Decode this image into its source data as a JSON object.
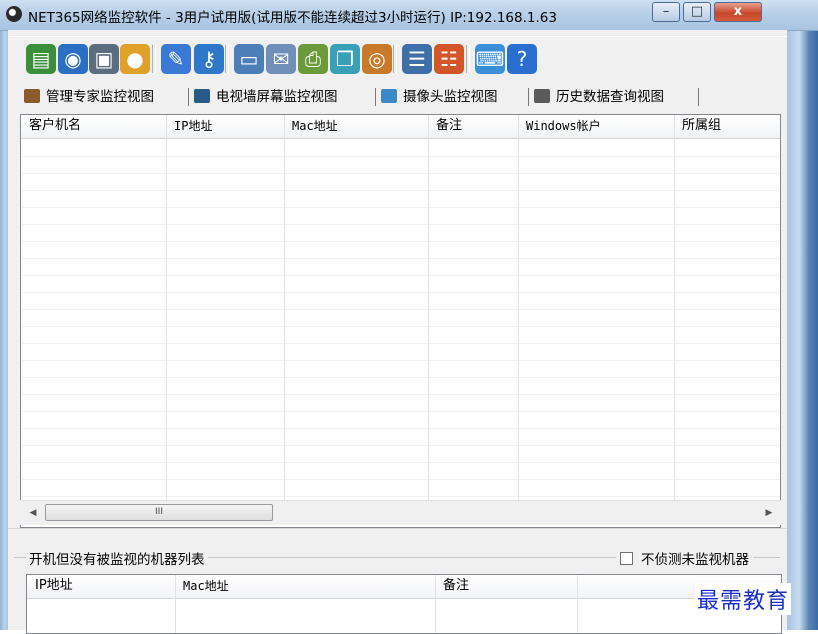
{
  "window": {
    "title": "NET365网络监控软件 - 3用户试用版(试用版不能连续超过3小时运行) IP:192.168.1.63",
    "minimize_glyph": "–",
    "maximize_glyph": "□",
    "close_glyph": "x"
  },
  "toolbar": {
    "buttons": [
      {
        "icon": "windows-stack-icon",
        "glyph": "▤",
        "color": "#3a8f3a"
      },
      {
        "icon": "globe-icon",
        "glyph": "◉",
        "color": "#2a6fc2"
      },
      {
        "icon": "monitor-settings-icon",
        "glyph": "▣",
        "color": "#5d6d80"
      },
      {
        "icon": "users-icon",
        "glyph": "●",
        "color": "#e0a12a"
      },
      {
        "icon": "chart-pen-icon",
        "glyph": "✎",
        "color": "#3a7ad6"
      },
      {
        "icon": "key-icon",
        "glyph": "⚷",
        "color": "#2f78c9"
      },
      {
        "icon": "remote-monitor-icon",
        "glyph": "▭",
        "color": "#4c7fb8"
      },
      {
        "icon": "mail-icon",
        "glyph": "✉",
        "color": "#6f8fb8"
      },
      {
        "icon": "document-search-icon",
        "glyph": "⎙",
        "color": "#6a9a3a"
      },
      {
        "icon": "windows-copy-icon",
        "glyph": "❐",
        "color": "#3aa0b8"
      },
      {
        "icon": "disc-icon",
        "glyph": "◎",
        "color": "#c87a2a"
      },
      {
        "icon": "list-panel-icon",
        "glyph": "☰",
        "color": "#3e6fa8"
      },
      {
        "icon": "user-report-icon",
        "glyph": "☷",
        "color": "#d2562a"
      },
      {
        "icon": "keyboard-icon",
        "glyph": "⌨",
        "color": "#3b8fd8"
      },
      {
        "icon": "help-icon",
        "glyph": "?",
        "color": "#2a6fd0"
      }
    ]
  },
  "tabs": [
    {
      "label": "管理专家监控视图",
      "icon": "manager-icon",
      "color": "#8a5a2a"
    },
    {
      "label": "电视墙屏幕监控视图",
      "icon": "tv-wall-icon",
      "color": "#2a5a8a"
    },
    {
      "label": "摄像头监控视图",
      "icon": "camera-icon",
      "color": "#3a8ac8"
    },
    {
      "label": "历史数据查询视图",
      "icon": "history-icon",
      "color": "#5a5a5a"
    }
  ],
  "client_table": {
    "columns": [
      "客户机名",
      "IP地址",
      "Mac地址",
      "备注",
      "Windows帐户",
      "所属组"
    ]
  },
  "hscroll": {
    "left_arrow": "◀",
    "right_arrow": "▶",
    "thumb_grip": "III"
  },
  "unmonitored": {
    "group_title": "开机但没有被监视的机器列表",
    "checkbox_label": "不侦测未监视机器",
    "checkbox_checked": false,
    "columns": [
      "IP地址",
      "Mac地址",
      "备注",
      ""
    ]
  },
  "watermark": "最需教育"
}
